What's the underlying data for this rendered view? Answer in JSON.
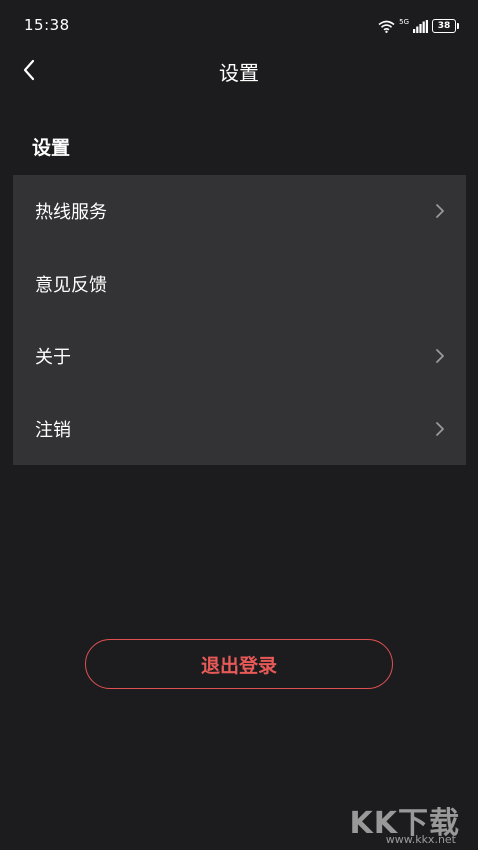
{
  "status_bar": {
    "time": "15:38",
    "network_label": "5G",
    "battery": "38"
  },
  "nav": {
    "title": "设置",
    "back_icon": "chevron-left-icon"
  },
  "section": {
    "title": "设置"
  },
  "settings": {
    "items": [
      {
        "label": "热线服务",
        "has_chevron": true
      },
      {
        "label": "意见反馈",
        "has_chevron": false
      },
      {
        "label": "关于",
        "has_chevron": true
      },
      {
        "label": "注销",
        "has_chevron": true
      }
    ]
  },
  "logout": {
    "label": "退出登录"
  },
  "watermark": {
    "logo": "KK下载",
    "url": "www.kkx.net"
  },
  "colors": {
    "background": "#1c1c1e",
    "card": "#333335",
    "accent": "#e85a57"
  }
}
